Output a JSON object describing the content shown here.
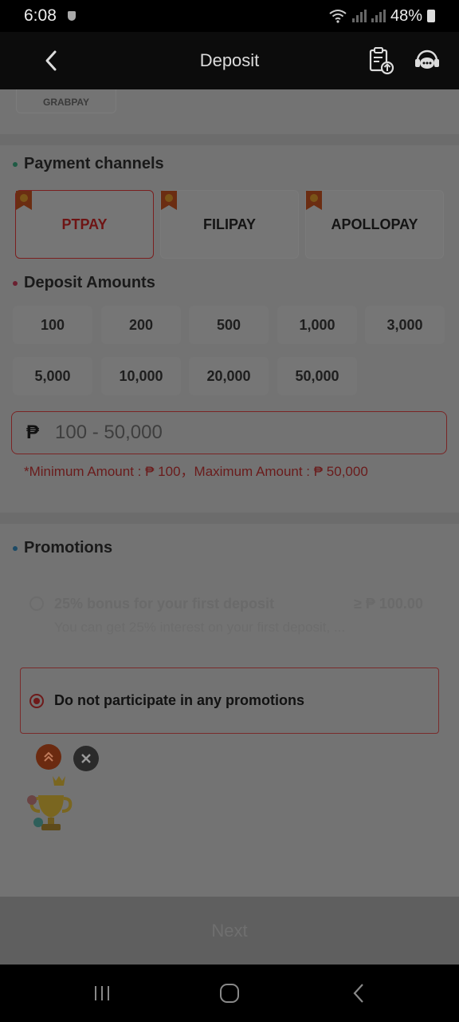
{
  "status_bar": {
    "time": "6:08",
    "battery": "48%"
  },
  "header": {
    "title": "Deposit",
    "icons": [
      "back-icon",
      "deposit-record-icon",
      "customer-service-icon"
    ]
  },
  "previous_method": {
    "label": "GRABPAY"
  },
  "payment_channels": {
    "title": "Payment channels",
    "channels": [
      {
        "label": "PTPAY",
        "selected": true
      },
      {
        "label": "FILIPAY",
        "selected": false
      },
      {
        "label": "APOLLOPAY",
        "selected": false
      }
    ]
  },
  "deposit_amounts": {
    "title": "Deposit Amounts",
    "options": [
      "100",
      "200",
      "500",
      "1,000",
      "3,000",
      "5,000",
      "10,000",
      "20,000",
      "50,000"
    ]
  },
  "amount_input": {
    "currency": "₱",
    "placeholder": "100 - 50,000",
    "hint": "*Minimum Amount : ₱ 100，Maximum Amount : ₱ 50,000"
  },
  "promotions": {
    "title": "Promotions",
    "first_bonus": {
      "title": "25% bonus for your first deposit",
      "min": "≥ ₱ 100.00",
      "desc": "You can get 25% interest on your first deposit, ..."
    },
    "no_promo": {
      "label": "Do not participate in any promotions",
      "selected": true
    }
  },
  "next_button": {
    "label": "Next"
  },
  "colors": {
    "accent": "#6e1414",
    "overlay": "#737373"
  }
}
